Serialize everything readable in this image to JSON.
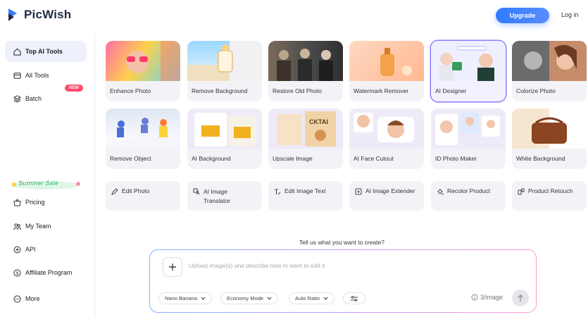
{
  "header": {
    "brand": "PicWish",
    "upgrade": "Upgrade",
    "login": "Log in"
  },
  "sidebar": {
    "items": [
      {
        "label": "Top AI Tools",
        "icon": "home-icon"
      },
      {
        "label": "All Tools",
        "icon": "grid-icon"
      },
      {
        "label": "Batch",
        "icon": "layers-icon"
      }
    ],
    "new_badge": "NEW",
    "sale": "Summer Sale",
    "bottom": [
      {
        "label": "Pricing",
        "icon": "basket-icon"
      },
      {
        "label": "My Team",
        "icon": "team-icon"
      },
      {
        "label": "API",
        "icon": "api-icon"
      },
      {
        "label": "Affiliate Program",
        "icon": "dollar-icon"
      },
      {
        "label": "More",
        "icon": "more-icon"
      }
    ]
  },
  "cards": [
    "Enhance Photo",
    "Remove Background",
    "Restore Old Photo",
    "Watermark Remover",
    "AI Designer",
    "Colorize Photo",
    "Remove Object",
    "AI Background",
    "Upscale Image",
    "AI Face Cutout",
    "ID Photo Maker",
    "White Background"
  ],
  "tools": [
    {
      "label": "Edit Photo",
      "icon": "edit-icon"
    },
    {
      "label": "AI Image Translator",
      "icon": "translate-icon"
    },
    {
      "label": "Edit Image Text",
      "icon": "text-edit-icon"
    },
    {
      "label": "AI Image Extender",
      "icon": "extend-icon"
    },
    {
      "label": "Recolor Product",
      "icon": "recolor-icon"
    },
    {
      "label": "Product Retouch",
      "icon": "retouch-icon"
    }
  ],
  "prompt": {
    "title": "Tell us what you want to create?",
    "placeholder": "Upload image(s) and describe how to want to edit it",
    "model": "Nano Banana",
    "mode": "Economy Mode",
    "ratio": "Auto Ratio",
    "credits": "3/image"
  }
}
